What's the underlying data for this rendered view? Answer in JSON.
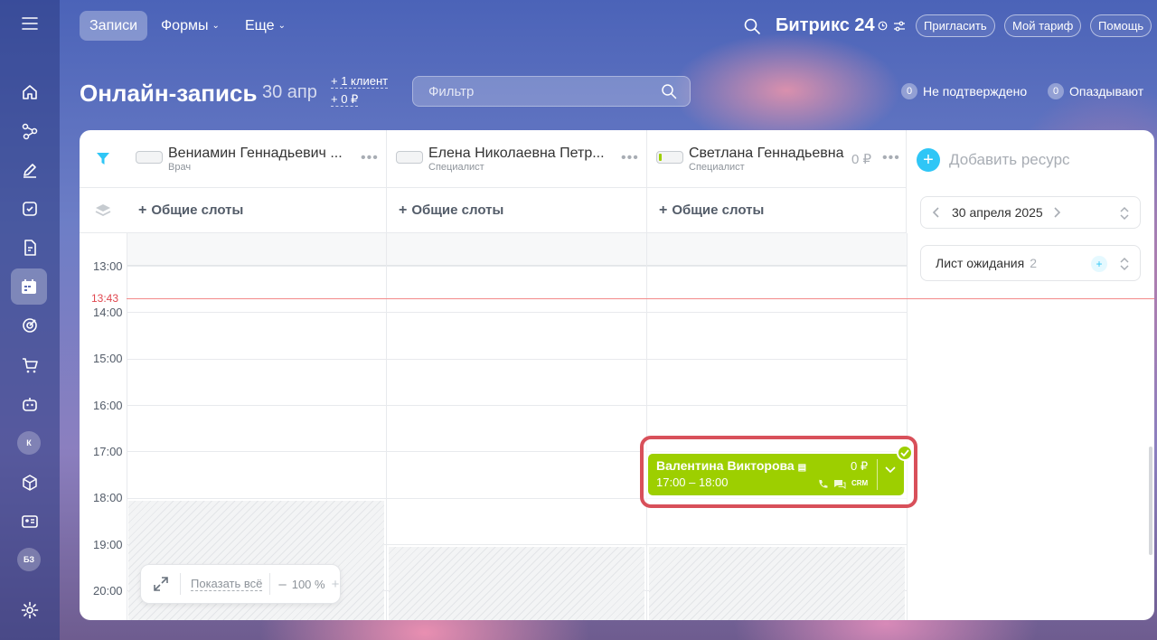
{
  "topbar": {
    "tabs": [
      {
        "label": "Записи",
        "active": true
      },
      {
        "label": "Формы",
        "dropdown": true
      },
      {
        "label": "Еще",
        "dropdown": true
      }
    ],
    "brand": "Битрикс 24",
    "invite": "Пригласить",
    "tariff": "Мой тариф",
    "help": "Помощь"
  },
  "sidebar": {
    "icons": [
      "menu-icon",
      "home-icon",
      "flow-icon",
      "pen-icon",
      "tasks-icon",
      "doc-icon",
      "calendar-booking-icon",
      "target-icon",
      "cart-icon",
      "robot-icon",
      "avatar-k",
      "box-icon",
      "contact-card-icon",
      "avatar-bz",
      "settings-icon"
    ],
    "avatar_k": "К",
    "avatar_bz": "БЗ"
  },
  "header": {
    "title": "Онлайн-запись",
    "date": "30 апр",
    "clients": "+ 1 клиент",
    "amount": "+ 0 ₽",
    "filter_placeholder": "Фильтр",
    "unconfirmed_count": "0",
    "unconfirmed_label": "Не подтверждено",
    "late_count": "0",
    "late_label": "Опаздывают"
  },
  "resources": [
    {
      "name": "Вениамин Геннадьевич ...",
      "role": "Врач",
      "price": ""
    },
    {
      "name": "Елена Николаевна Петр...",
      "role": "Специалист",
      "price": ""
    },
    {
      "name": "Светлана Геннадьевна",
      "role": "Специалист",
      "price": "0 ₽"
    }
  ],
  "common_slots_label": "Общие слоты",
  "times": [
    "13:00",
    "14:00",
    "15:00",
    "16:00",
    "17:00",
    "18:00",
    "19:00",
    "20:00"
  ],
  "now_time": "13:43",
  "booking": {
    "client": "Валентина Викторова",
    "time": "17:00 – 18:00",
    "price": "0 ₽",
    "crm": "CRM",
    "status_color": "#9dcf00"
  },
  "zoom": {
    "show_all": "Показать всё",
    "value": "100 %"
  },
  "right_panel": {
    "add_resource": "Добавить ресурс",
    "date": "30 апреля 2025",
    "waitlist_label": "Лист ожидания",
    "waitlist_count": "2"
  },
  "colors": {
    "accent": "#2fc6f6",
    "booking": "#9dcf00",
    "now_line": "#f38a8a",
    "highlight": "#d8505a"
  }
}
